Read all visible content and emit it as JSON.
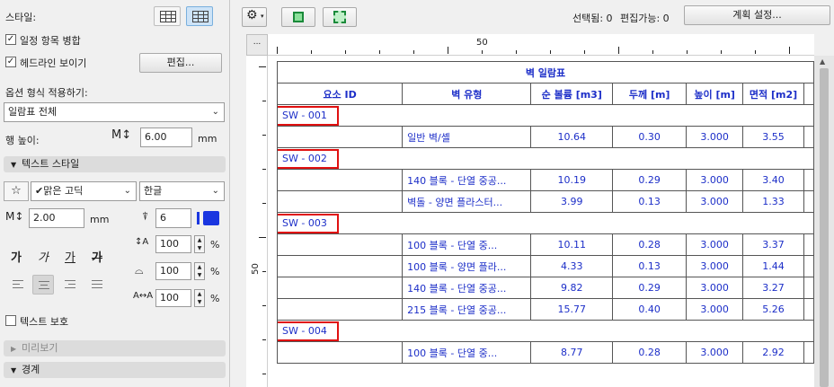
{
  "left_panel": {
    "style_label": "스타일:",
    "merge_label": "일정 항목 병합",
    "merge_checked": true,
    "headline_label": "헤드라인 보이기",
    "headline_checked": true,
    "edit_button": "편집...",
    "apply_format_label": "옵션 형식 적용하기:",
    "apply_format_value": "일람표 전체",
    "row_height_label": "행 높이:",
    "row_height_value": "6.00",
    "row_height_unit": "mm",
    "text_style_section": "텍스트 스타일",
    "font_name": "맑은 고딕",
    "font_check": "✔",
    "language": "한글",
    "font_size_value": "2.00",
    "font_size_unit": "mm",
    "pen_value": "6",
    "font_style_samples": [
      "가",
      "가",
      "가",
      "가"
    ],
    "line_spacing_value": "100",
    "width_factor_value": "100",
    "char_spacing_value": "100",
    "percent": "%",
    "protect_text_label": "텍스트 보호",
    "protect_text_checked": false,
    "preview_section": "미리보기",
    "border_section": "경계"
  },
  "toolbar": {
    "selected_label": "선택됨: 0",
    "editable_label": "편집가능: 0",
    "settings_button": "계획 설정..."
  },
  "ruler": {
    "corner_label": "...",
    "top_mark": "50",
    "left_mark": "50"
  },
  "schedule": {
    "title": "벽 일람표",
    "columns": [
      "요소 ID",
      "벽 유형",
      "순 볼륨 [m3]",
      "두께 [m]",
      "높이 [m]",
      "면적 [m2]"
    ],
    "groups": [
      {
        "id": "SW - 001",
        "rows": [
          {
            "type": "일반 벽/셸",
            "volume": "10.64",
            "thickness": "0.30",
            "height": "3.000",
            "area": "3.55"
          }
        ]
      },
      {
        "id": "SW - 002",
        "rows": [
          {
            "type": "140 블록 - 단열 중공...",
            "volume": "10.19",
            "thickness": "0.29",
            "height": "3.000",
            "area": "3.40"
          },
          {
            "type": "벽돌 - 양면 플라스터...",
            "volume": "3.99",
            "thickness": "0.13",
            "height": "3.000",
            "area": "1.33"
          }
        ]
      },
      {
        "id": "SW - 003",
        "rows": [
          {
            "type": "100 블록 - 단열 중...",
            "volume": "10.11",
            "thickness": "0.28",
            "height": "3.000",
            "area": "3.37"
          },
          {
            "type": "100 블록 - 양면 플라...",
            "volume": "4.33",
            "thickness": "0.13",
            "height": "3.000",
            "area": "1.44"
          },
          {
            "type": "140 블록 - 단열 중공...",
            "volume": "9.82",
            "thickness": "0.29",
            "height": "3.000",
            "area": "3.27"
          },
          {
            "type": "215 블록 - 단열 중공...",
            "volume": "15.77",
            "thickness": "0.40",
            "height": "3.000",
            "area": "5.26"
          }
        ]
      },
      {
        "id": "SW - 004",
        "rows": [
          {
            "type": "100 블록 - 단열 중...",
            "volume": "8.77",
            "thickness": "0.28",
            "height": "3.000",
            "area": "2.92"
          }
        ]
      }
    ]
  },
  "colors": {
    "table_text": "#1c2ec8",
    "highlight_box": "#e01010",
    "selected_icon_bg": "#cde3f7"
  }
}
